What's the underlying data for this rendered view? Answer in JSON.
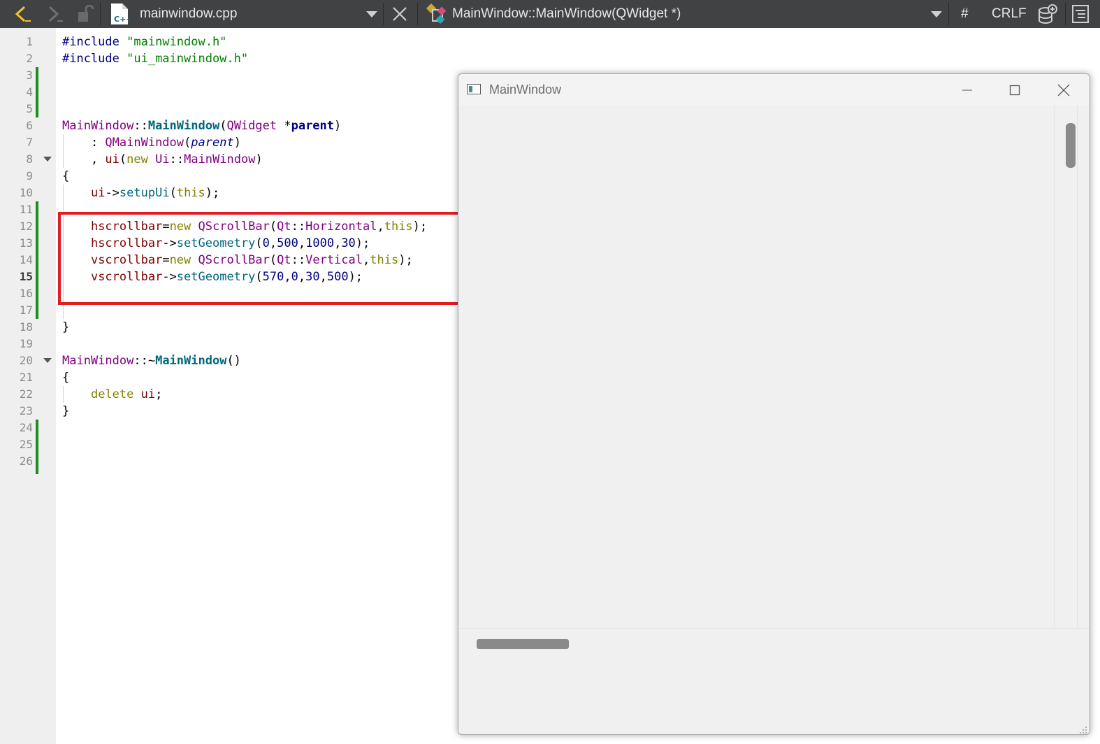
{
  "toolbar": {
    "file_name": "mainwindow.cpp",
    "file_type_badge": "C++",
    "symbol": "MainWindow::MainWindow(QWidget *)",
    "hash_label": "#",
    "line_ending": "CRLF",
    "icons": [
      "back-arrow-icon",
      "forward-arrow-icon",
      "lock-icon",
      "cpp-file-icon",
      "close-icon",
      "symbol-icon",
      "database-icon",
      "outline-icon"
    ],
    "accent_color": "#f0c430"
  },
  "editor": {
    "current_line": 15,
    "line_numbers": [
      "1",
      "2",
      "3",
      "4",
      "5",
      "6",
      "7",
      "8",
      "9",
      "10",
      "11",
      "12",
      "13",
      "14",
      "15",
      "16",
      "17",
      "18",
      "19",
      "20",
      "21",
      "22",
      "23",
      "24",
      "25",
      "26"
    ],
    "folded_lines": [
      8,
      20
    ],
    "changed_line_ranges": [
      [
        3,
        5
      ],
      [
        11,
        17
      ],
      [
        24,
        26
      ]
    ],
    "lines": [
      "#include \"mainwindow.h\"",
      "#include \"ui_mainwindow.h\"",
      "",
      "",
      "",
      "MainWindow::MainWindow(QWidget *parent)",
      "    : QMainWindow(parent)",
      "    , ui(new Ui::MainWindow)",
      "{",
      "    ui->setupUi(this);",
      "",
      "    hscrollbar=new QScrollBar(Qt::Horizontal,this);",
      "    hscrollbar->setGeometry(0,500,1000,30);",
      "    vscrollbar=new QScrollBar(Qt::Vertical,this);",
      "    vscrollbar->setGeometry(570,0,30,500);",
      "",
      "",
      "}",
      "",
      "MainWindow::~MainWindow()",
      "{",
      "    delete ui;",
      "}",
      "",
      "",
      ""
    ],
    "highlight_color": "#e31c23"
  },
  "app_window": {
    "title": "MainWindow",
    "icons": [
      "app-window-icon",
      "minimize-icon",
      "maximize-icon",
      "close-icon"
    ]
  }
}
